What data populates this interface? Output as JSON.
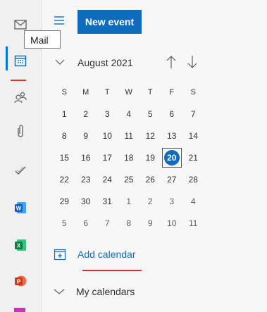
{
  "rail": {
    "tooltip": "Mail",
    "items": [
      "mail",
      "calendar",
      "people",
      "files",
      "todo",
      "word",
      "excel",
      "powerpoint"
    ]
  },
  "toolbar": {
    "new_event_label": "New event"
  },
  "calendar": {
    "month_label": "August 2021",
    "weekdays": [
      "S",
      "M",
      "T",
      "W",
      "T",
      "F",
      "S"
    ],
    "weeks": [
      [
        "1",
        "2",
        "3",
        "4",
        "5",
        "6",
        "7"
      ],
      [
        "8",
        "9",
        "10",
        "11",
        "12",
        "13",
        "14"
      ],
      [
        "15",
        "16",
        "17",
        "18",
        "19",
        "20",
        "21"
      ],
      [
        "22",
        "23",
        "24",
        "25",
        "26",
        "27",
        "28"
      ],
      [
        "29",
        "30",
        "31",
        "1",
        "2",
        "3",
        "4"
      ],
      [
        "5",
        "6",
        "7",
        "8",
        "9",
        "10",
        "11"
      ]
    ],
    "selected_day": "20"
  },
  "links": {
    "add_calendar": "Add calendar",
    "my_calendars": "My calendars"
  },
  "colors": {
    "accent": "#0f6cbd",
    "annotation_red": "#e03030"
  }
}
